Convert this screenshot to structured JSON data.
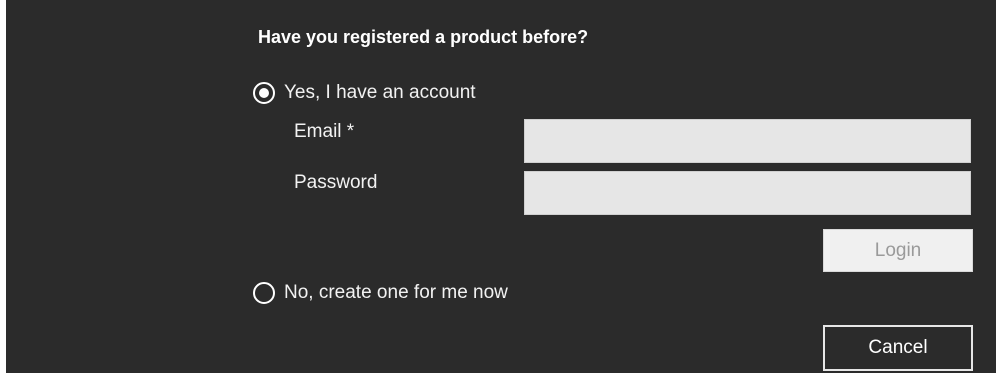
{
  "dialog": {
    "heading": "Have you registered a product before?",
    "options": {
      "yes": {
        "label": "Yes, I have an account",
        "selected": true
      },
      "no": {
        "label": "No, create one for me now",
        "selected": false
      }
    },
    "form": {
      "email_label": "Email *",
      "email_value": "",
      "password_label": "Password",
      "password_value": "",
      "login_label": "Login"
    },
    "cancel_label": "Cancel"
  },
  "colors": {
    "background": "#2b2b2b",
    "text": "#f2f2f2",
    "input_background": "#e6e6e6",
    "disabled_button_text": "#9a9a9a"
  },
  "icons": {
    "radio_selected": "radio-selected-icon",
    "radio_unselected": "radio-unselected-icon"
  }
}
